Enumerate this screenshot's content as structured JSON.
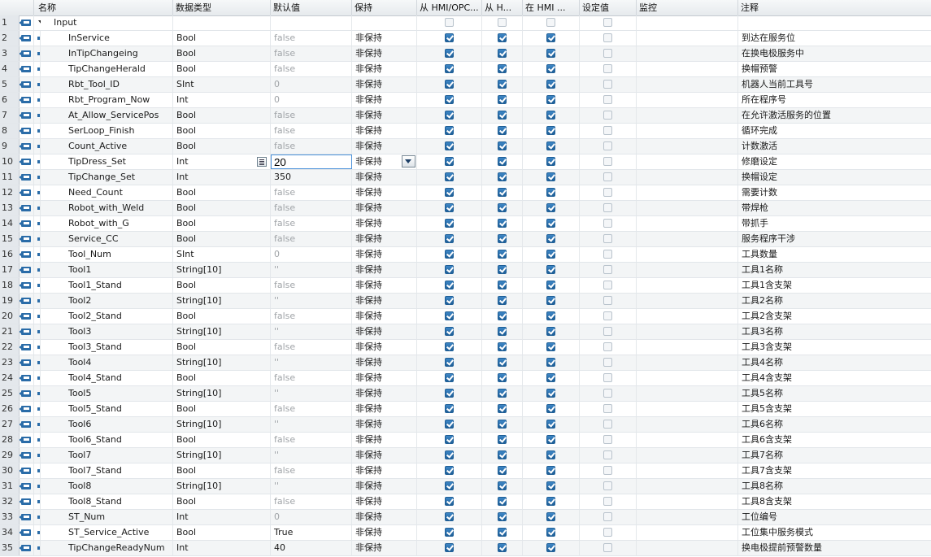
{
  "columns": {
    "name": "名称",
    "type": "数据类型",
    "default": "默认值",
    "retain": "保持",
    "hmi_opc": "从 HMI/OPC...",
    "hmi_h": "从 H...",
    "in_hmi": "在 HMI ...",
    "setpoint": "设定值",
    "monitor": "监控",
    "comment": "注释"
  },
  "group": {
    "num": "1",
    "name": "Input"
  },
  "editing": {
    "row": "10",
    "value": "20"
  },
  "rows": [
    {
      "num": "2",
      "name": "InService",
      "type": "Bool",
      "default": "false",
      "retain": "非保持",
      "comment": "到达在服务位"
    },
    {
      "num": "3",
      "name": "InTipChangeing",
      "type": "Bool",
      "default": "false",
      "retain": "非保持",
      "comment": "在换电极服务中"
    },
    {
      "num": "4",
      "name": "TipChangeHerald",
      "type": "Bool",
      "default": "false",
      "retain": "非保持",
      "comment": "换帽预警"
    },
    {
      "num": "5",
      "name": "Rbt_Tool_ID",
      "type": "SInt",
      "default": "0",
      "retain": "非保持",
      "comment": "机器人当前工具号"
    },
    {
      "num": "6",
      "name": "Rbt_Program_Now",
      "type": "Int",
      "default": "0",
      "retain": "非保持",
      "comment": "所在程序号"
    },
    {
      "num": "7",
      "name": "At_Allow_ServicePos",
      "type": "Bool",
      "default": "false",
      "retain": "非保持",
      "comment": "在允许激活服务的位置"
    },
    {
      "num": "8",
      "name": "SerLoop_Finish",
      "type": "Bool",
      "default": "false",
      "retain": "非保持",
      "comment": "循环完成"
    },
    {
      "num": "9",
      "name": "Count_Active",
      "type": "Bool",
      "default": "false",
      "retain": "非保持",
      "comment": "计数激活"
    },
    {
      "num": "10",
      "name": "TipDress_Set",
      "type": "Int",
      "default": "20",
      "retain": "非保持",
      "comment": "修磨设定"
    },
    {
      "num": "11",
      "name": "TipChange_Set",
      "type": "Int",
      "default": "350",
      "retain": "非保持",
      "comment": "换帽设定"
    },
    {
      "num": "12",
      "name": "Need_Count",
      "type": "Bool",
      "default": "false",
      "retain": "非保持",
      "comment": "需要计数"
    },
    {
      "num": "13",
      "name": "Robot_with_Weld",
      "type": "Bool",
      "default": "false",
      "retain": "非保持",
      "comment": "带焊枪"
    },
    {
      "num": "14",
      "name": "Robot_with_G",
      "type": "Bool",
      "default": "false",
      "retain": "非保持",
      "comment": "带抓手"
    },
    {
      "num": "15",
      "name": "Service_CC",
      "type": "Bool",
      "default": "false",
      "retain": "非保持",
      "comment": "服务程序干涉"
    },
    {
      "num": "16",
      "name": "Tool_Num",
      "type": "SInt",
      "default": "0",
      "retain": "非保持",
      "comment": "工具数量"
    },
    {
      "num": "17",
      "name": "Tool1",
      "type": "String[10]",
      "default": "''",
      "retain": "非保持",
      "comment": "工具1名称"
    },
    {
      "num": "18",
      "name": "Tool1_Stand",
      "type": "Bool",
      "default": "false",
      "retain": "非保持",
      "comment": "工具1含支架"
    },
    {
      "num": "19",
      "name": "Tool2",
      "type": "String[10]",
      "default": "''",
      "retain": "非保持",
      "comment": "工具2名称"
    },
    {
      "num": "20",
      "name": "Tool2_Stand",
      "type": "Bool",
      "default": "false",
      "retain": "非保持",
      "comment": "工具2含支架"
    },
    {
      "num": "21",
      "name": "Tool3",
      "type": "String[10]",
      "default": "''",
      "retain": "非保持",
      "comment": "工具3名称"
    },
    {
      "num": "22",
      "name": "Tool3_Stand",
      "type": "Bool",
      "default": "false",
      "retain": "非保持",
      "comment": "工具3含支架"
    },
    {
      "num": "23",
      "name": "Tool4",
      "type": "String[10]",
      "default": "''",
      "retain": "非保持",
      "comment": "工具4名称"
    },
    {
      "num": "24",
      "name": "Tool4_Stand",
      "type": "Bool",
      "default": "false",
      "retain": "非保持",
      "comment": "工具4含支架"
    },
    {
      "num": "25",
      "name": "Tool5",
      "type": "String[10]",
      "default": "''",
      "retain": "非保持",
      "comment": "工具5名称"
    },
    {
      "num": "26",
      "name": "Tool5_Stand",
      "type": "Bool",
      "default": "false",
      "retain": "非保持",
      "comment": "工具5含支架"
    },
    {
      "num": "27",
      "name": "Tool6",
      "type": "String[10]",
      "default": "''",
      "retain": "非保持",
      "comment": "工具6名称"
    },
    {
      "num": "28",
      "name": "Tool6_Stand",
      "type": "Bool",
      "default": "false",
      "retain": "非保持",
      "comment": "工具6含支架"
    },
    {
      "num": "29",
      "name": "Tool7",
      "type": "String[10]",
      "default": "''",
      "retain": "非保持",
      "comment": "工具7名称"
    },
    {
      "num": "30",
      "name": "Tool7_Stand",
      "type": "Bool",
      "default": "false",
      "retain": "非保持",
      "comment": "工具7含支架"
    },
    {
      "num": "31",
      "name": "Tool8",
      "type": "String[10]",
      "default": "''",
      "retain": "非保持",
      "comment": "工具8名称"
    },
    {
      "num": "32",
      "name": "Tool8_Stand",
      "type": "Bool",
      "default": "false",
      "retain": "非保持",
      "comment": "工具8含支架"
    },
    {
      "num": "33",
      "name": "ST_Num",
      "type": "Int",
      "default": "0",
      "retain": "非保持",
      "comment": "工位编号"
    },
    {
      "num": "34",
      "name": "ST_Service_Active",
      "type": "Bool",
      "default": "True",
      "retain": "非保持",
      "comment": "工位集中服务模式"
    },
    {
      "num": "35",
      "name": "TipChangeReadyNum",
      "type": "Int",
      "default": "40",
      "retain": "非保持",
      "comment": "换电极提前预警数量"
    }
  ]
}
